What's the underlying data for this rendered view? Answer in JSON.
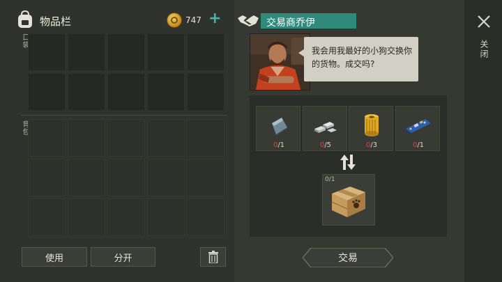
{
  "inventory": {
    "title": "物品栏",
    "coins": "747",
    "pocket_label": "口袋",
    "backpack_label": "背包",
    "use_button": "使用",
    "split_button": "分开"
  },
  "trader": {
    "name": "交易商乔伊",
    "message": "我会用我最好的小狗交换你的货物。成交吗?",
    "requirements": [
      {
        "icon": "metal-plate-icon",
        "current": "0",
        "required": "/1"
      },
      {
        "icon": "metal-bars-icon",
        "current": "0",
        "required": "/5"
      },
      {
        "icon": "oil-filter-icon",
        "current": "0",
        "required": "/3"
      },
      {
        "icon": "circuit-board-icon",
        "current": "0",
        "required": "/1"
      }
    ],
    "reward": {
      "icon": "dog-crate-box-icon",
      "count": "0/1"
    },
    "trade_button": "交易"
  },
  "close_label": "关闭",
  "colors": {
    "accent_teal": "#2f8a7c",
    "plus_teal": "#3fb8a5",
    "count_red": "#d9473d"
  }
}
